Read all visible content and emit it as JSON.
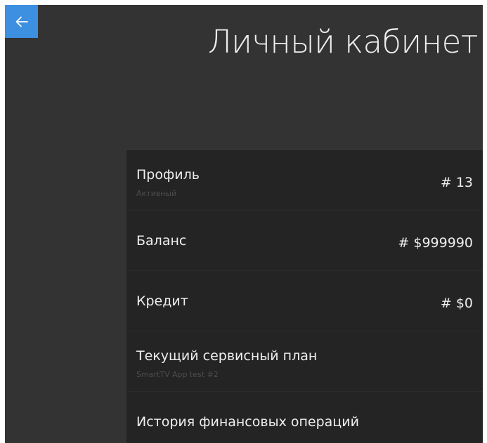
{
  "header": {
    "back_icon": "arrow-left-icon",
    "title": "Личный кабинет"
  },
  "colors": {
    "back_button": "#3d8fe0",
    "background": "#333333",
    "panel": "#252424",
    "text": "#eeeeee",
    "subtext": "#4d4d4d"
  },
  "rows": [
    {
      "label": "Профиль",
      "sub": "Активный",
      "value": "# 13"
    },
    {
      "label": "Баланс",
      "sub": "",
      "value": "# $999990"
    },
    {
      "label": "Кредит",
      "sub": "",
      "value": "# $0"
    },
    {
      "label": "Текущий сервисный план",
      "sub": "SmartTV App test #2",
      "value": ""
    },
    {
      "label": "История финансовых операций",
      "sub": "",
      "value": ""
    }
  ]
}
